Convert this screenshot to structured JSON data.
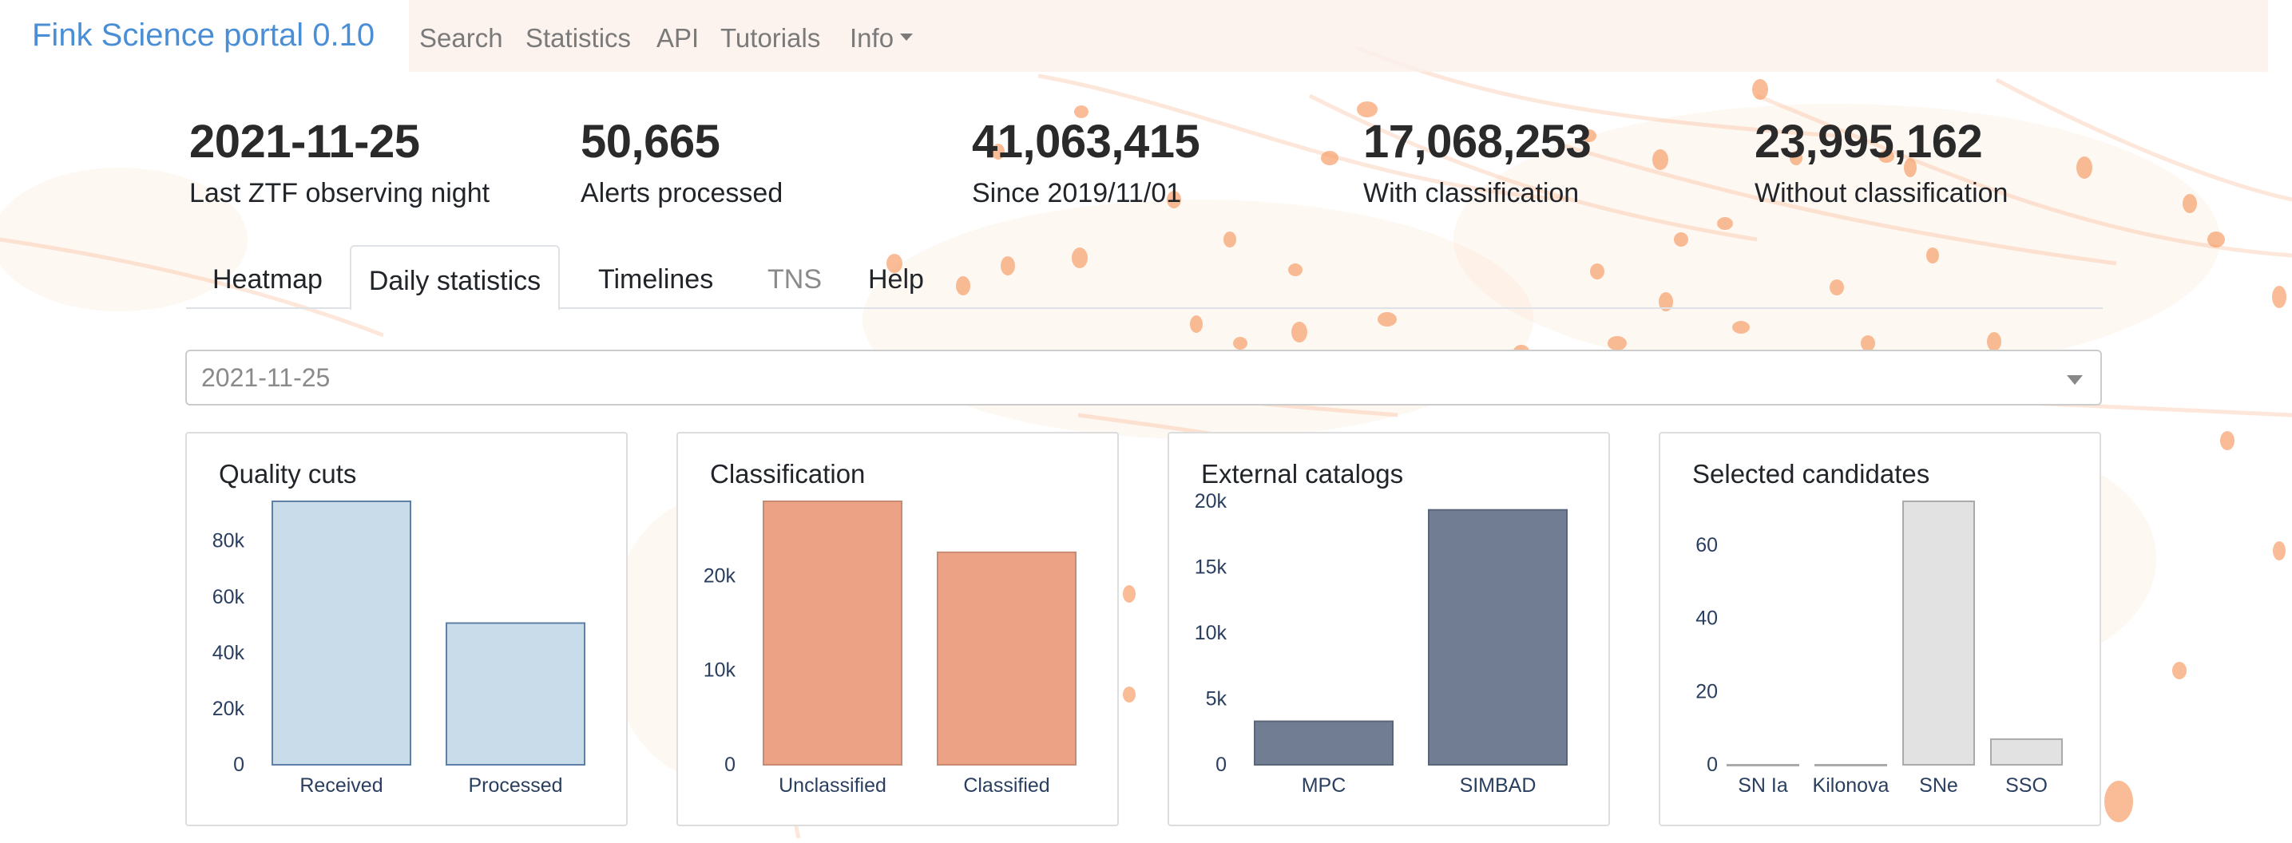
{
  "app": {
    "title": "Fink Science portal 0.10"
  },
  "nav": {
    "items": [
      {
        "label": "Search"
      },
      {
        "label": "Statistics"
      },
      {
        "label": "API"
      },
      {
        "label": "Tutorials"
      },
      {
        "label": "Info",
        "has_caret": true
      }
    ]
  },
  "stats": [
    {
      "value": "2021-11-25",
      "label": "Last ZTF observing night"
    },
    {
      "value": "50,665",
      "label": "Alerts processed"
    },
    {
      "value": "41,063,415",
      "label": "Since 2019/11/01"
    },
    {
      "value": "17,068,253",
      "label": "With classification"
    },
    {
      "value": "23,995,162",
      "label": "Without classification"
    }
  ],
  "tabs": [
    {
      "label": "Heatmap",
      "state": "normal"
    },
    {
      "label": "Daily statistics",
      "state": "active"
    },
    {
      "label": "Timelines",
      "state": "normal"
    },
    {
      "label": "TNS",
      "state": "disabled"
    },
    {
      "label": "Help",
      "state": "normal"
    }
  ],
  "date_select": {
    "value": "2021-11-25"
  },
  "colors": {
    "brand": "#4a8fd6",
    "bar_quality": "#c9dcea",
    "bar_quality_edge": "#5f7fa6",
    "bar_class": "#eba285",
    "bar_class_edge": "#c98a72",
    "bar_catalog": "#717d93",
    "bar_catalog_edge": "#5a6578",
    "bar_candidates": "#e2e2e2",
    "bar_candidates_edge": "#aaaaaa",
    "background_splash": "#f6a06a"
  },
  "chart_data": [
    {
      "type": "bar",
      "title": "Quality cuts",
      "categories": [
        "Received",
        "Processed"
      ],
      "values": [
        94200,
        50665
      ],
      "ylim": [
        0,
        94200
      ],
      "yticks": [
        0,
        20000,
        40000,
        60000,
        80000
      ],
      "ytick_labels": [
        "0",
        "20k",
        "40k",
        "60k",
        "80k"
      ]
    },
    {
      "type": "bar",
      "title": "Classification",
      "categories": [
        "Unclassified",
        "Classified"
      ],
      "values": [
        27900,
        22500
      ],
      "ylim": [
        0,
        27900
      ],
      "yticks": [
        0,
        10000,
        20000
      ],
      "ytick_labels": [
        "0",
        "10k",
        "20k"
      ]
    },
    {
      "type": "bar",
      "title": "External catalogs",
      "categories": [
        "MPC",
        "SIMBAD"
      ],
      "values": [
        3300,
        19350
      ],
      "ylim": [
        0,
        20000
      ],
      "yticks": [
        0,
        5000,
        10000,
        15000,
        20000
      ],
      "ytick_labels": [
        "0",
        "5k",
        "10k",
        "15k",
        "20k"
      ]
    },
    {
      "type": "bar",
      "title": "Selected candidates",
      "categories": [
        "SN Ia",
        "Kilonova",
        "SNe",
        "SSO"
      ],
      "values": [
        0,
        0,
        72,
        7
      ],
      "ylim": [
        0,
        72
      ],
      "yticks": [
        0,
        20,
        40,
        60
      ],
      "ytick_labels": [
        "0",
        "20",
        "40",
        "60"
      ]
    }
  ]
}
